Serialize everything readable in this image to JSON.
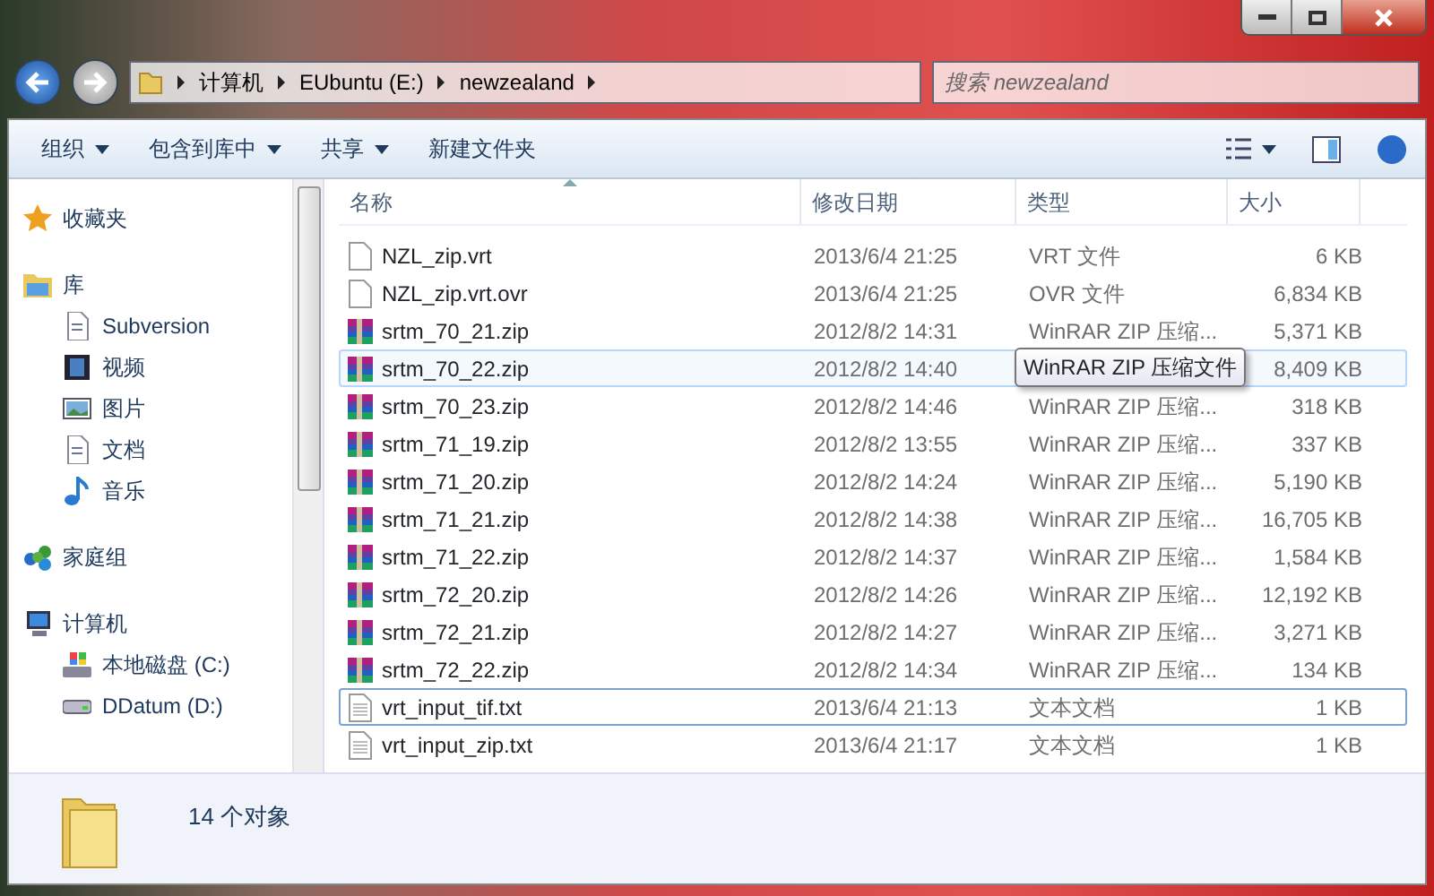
{
  "address": {
    "crumbs": [
      "计算机",
      "EUbuntu (E:)",
      "newzealand"
    ]
  },
  "search": {
    "placeholder": "搜索 newzealand"
  },
  "toolbar": {
    "items": [
      {
        "label": "组织",
        "dropdown": true
      },
      {
        "label": "包含到库中",
        "dropdown": true
      },
      {
        "label": "共享",
        "dropdown": true
      },
      {
        "label": "新建文件夹",
        "dropdown": false
      }
    ]
  },
  "sidebar": {
    "items": [
      {
        "label": "收藏夹"
      },
      {
        "label": "库",
        "children": [
          {
            "label": "Subversion"
          },
          {
            "label": "视频"
          },
          {
            "label": "图片"
          },
          {
            "label": "文档"
          },
          {
            "label": "音乐"
          }
        ]
      },
      {
        "label": "家庭组"
      },
      {
        "label": "计算机",
        "children": [
          {
            "label": "本地磁盘 (C:)"
          },
          {
            "label": "DDatum (D:)"
          }
        ]
      }
    ]
  },
  "table": {
    "columns": [
      "名称",
      "修改日期",
      "类型",
      "大小"
    ],
    "rows": [
      {
        "name": "NZL_zip.vrt",
        "kind": "file",
        "date": "2013/6/4 21:25",
        "type": "VRT 文件",
        "size": "6 KB",
        "hovered": false,
        "focused": false
      },
      {
        "name": "NZL_zip.vrt.ovr",
        "kind": "file",
        "date": "2013/6/4 21:25",
        "type": "OVR 文件",
        "size": "6,834 KB",
        "hovered": false,
        "focused": false
      },
      {
        "name": "srtm_70_21.zip",
        "kind": "archive",
        "date": "2012/8/2 14:31",
        "type": "WinRAR ZIP 压缩...",
        "size": "5,371 KB",
        "hovered": false,
        "focused": false
      },
      {
        "name": "srtm_70_22.zip",
        "kind": "archive",
        "date": "2012/8/2 14:40",
        "size": "8,409 KB",
        "hovered": true,
        "focused": false,
        "tooltip": "WinRAR ZIP 压缩文件"
      },
      {
        "name": "srtm_70_23.zip",
        "kind": "archive",
        "date": "2012/8/2 14:46",
        "type": "WinRAR ZIP 压缩...",
        "size": "318 KB",
        "hovered": false,
        "focused": false
      },
      {
        "name": "srtm_71_19.zip",
        "kind": "archive",
        "date": "2012/8/2 13:55",
        "type": "WinRAR ZIP 压缩...",
        "size": "337 KB",
        "hovered": false,
        "focused": false
      },
      {
        "name": "srtm_71_20.zip",
        "kind": "archive",
        "date": "2012/8/2 14:24",
        "type": "WinRAR ZIP 压缩...",
        "size": "5,190 KB",
        "hovered": false,
        "focused": false
      },
      {
        "name": "srtm_71_21.zip",
        "kind": "archive",
        "date": "2012/8/2 14:38",
        "type": "WinRAR ZIP 压缩...",
        "size": "16,705 KB",
        "hovered": false,
        "focused": false
      },
      {
        "name": "srtm_71_22.zip",
        "kind": "archive",
        "date": "2012/8/2 14:37",
        "type": "WinRAR ZIP 压缩...",
        "size": "1,584 KB",
        "hovered": false,
        "focused": false
      },
      {
        "name": "srtm_72_20.zip",
        "kind": "archive",
        "date": "2012/8/2 14:26",
        "type": "WinRAR ZIP 压缩...",
        "size": "12,192 KB",
        "hovered": false,
        "focused": false
      },
      {
        "name": "srtm_72_21.zip",
        "kind": "archive",
        "date": "2012/8/2 14:27",
        "type": "WinRAR ZIP 压缩...",
        "size": "3,271 KB",
        "hovered": false,
        "focused": false
      },
      {
        "name": "srtm_72_22.zip",
        "kind": "archive",
        "date": "2012/8/2 14:34",
        "type": "WinRAR ZIP 压缩...",
        "size": "134 KB",
        "hovered": false,
        "focused": false
      },
      {
        "name": "vrt_input_tif.txt",
        "kind": "text",
        "date": "2013/6/4 21:13",
        "type": "文本文档",
        "size": "1 KB",
        "hovered": false,
        "focused": true
      },
      {
        "name": "vrt_input_zip.txt",
        "kind": "text",
        "date": "2013/6/4 21:17",
        "type": "文本文档",
        "size": "1 KB",
        "hovered": false,
        "focused": false
      }
    ]
  },
  "status_bar": {
    "text": "14 个对象"
  }
}
